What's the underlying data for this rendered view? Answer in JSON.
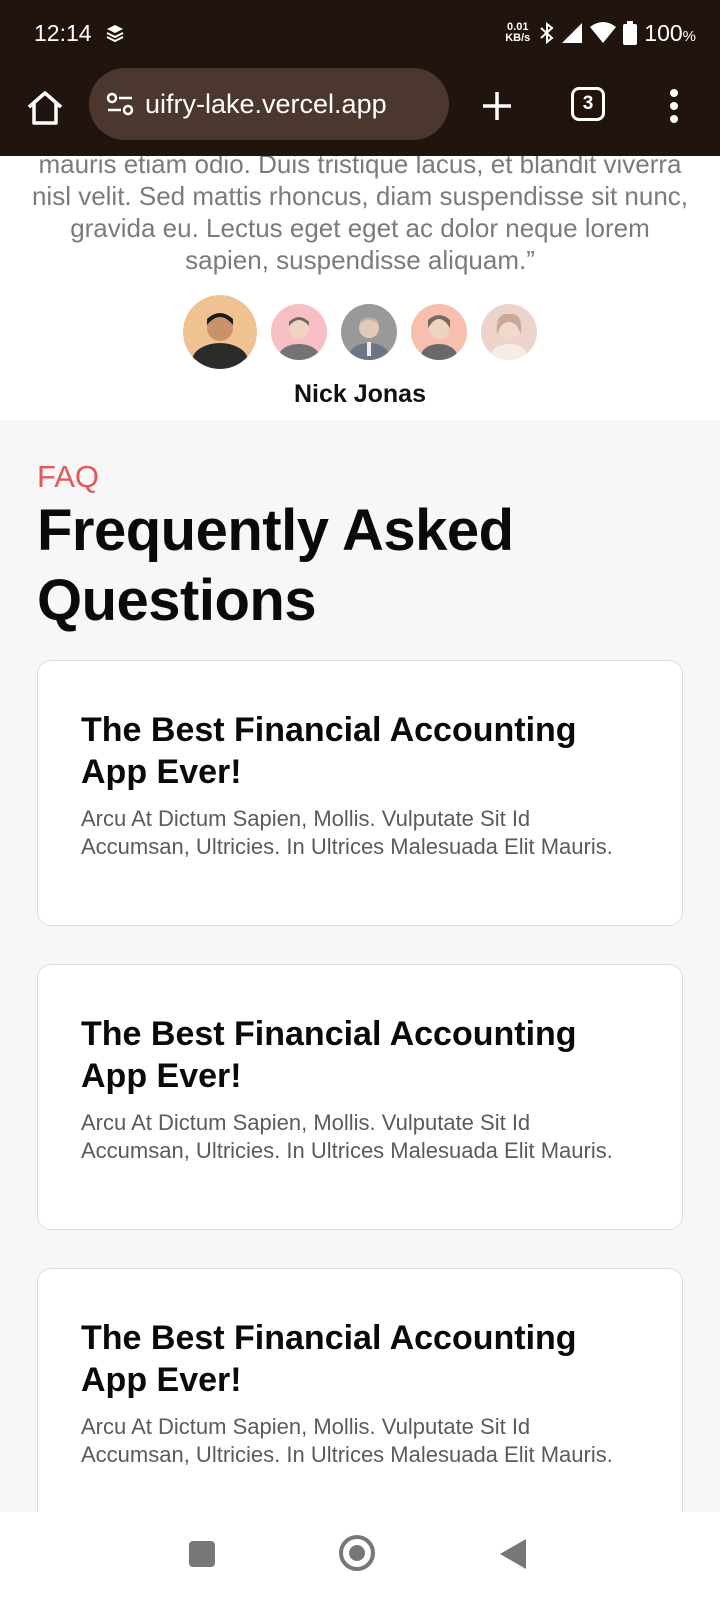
{
  "status_bar": {
    "time": "12:14",
    "net_speed_value": "0.01",
    "net_speed_unit": "KB/s",
    "battery_percent": "100",
    "battery_unit": "%"
  },
  "browser": {
    "url": "uifry-lake.vercel.app",
    "tab_count": "3"
  },
  "testimonial": {
    "quote": "mauris etiam odio. Duis tristique lacus, et blandit viverra nisl velit. Sed mattis rhoncus, diam suspendisse sit nunc, gravida eu. Lectus eget eget ac dolor neque lorem sapien, suspendisse aliquam.”",
    "author": "Nick Jonas"
  },
  "faq": {
    "kicker": "FAQ",
    "title": "Frequently Asked Questions",
    "items": [
      {
        "question": "The Best Financial Accounting App Ever!",
        "answer": "Arcu At Dictum Sapien, Mollis. Vulputate Sit Id Accumsan, Ultricies. In Ultrices Malesuada Elit Mauris."
      },
      {
        "question": "The Best Financial Accounting App Ever!",
        "answer": "Arcu At Dictum Sapien, Mollis. Vulputate Sit Id Accumsan, Ultricies. In Ultrices Malesuada Elit Mauris."
      },
      {
        "question": "The Best Financial Accounting App Ever!",
        "answer": "Arcu At Dictum Sapien, Mollis. Vulputate Sit Id Accumsan, Ultricies. In Ultrices Malesuada Elit Mauris."
      }
    ]
  },
  "colors": {
    "browser_chrome": "#21140f",
    "url_pill": "#4b372e",
    "accent": "#e4585b"
  }
}
